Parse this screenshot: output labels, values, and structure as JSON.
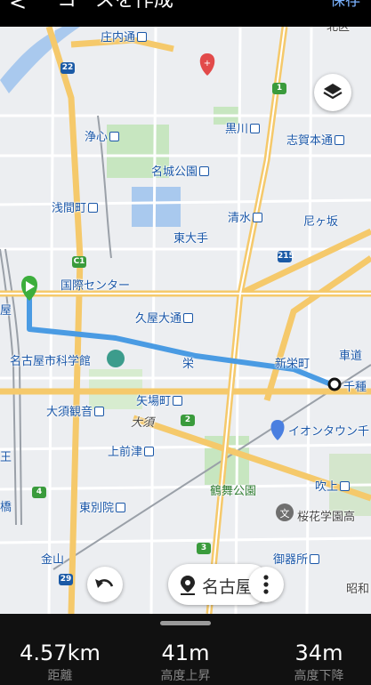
{
  "header": {
    "back_glyph": "<",
    "title": "コースを作成",
    "save_label": "保存"
  },
  "map": {
    "labels": {
      "kita_ku": "北区",
      "shounai_dori": "庄内通",
      "jyoshin": "浄心",
      "kuroka": "黒川",
      "shigahondori": "志賀本通",
      "meijo_koen": "名城公園",
      "sengen_cho": "浅間町",
      "shimizu": "清水",
      "amagasaka": "尼ヶ坂",
      "higashi_ote": "東大手",
      "kokusai_center": "国際センター",
      "hisaya_odori": "久屋大通",
      "nagoya_left": "屋",
      "sakae": "栄",
      "shinsakae": "新栄町",
      "kurumamichi": "車道",
      "chikusa": "千種",
      "science_museum": "名古屋市科学館",
      "yabacho": "矢場町",
      "osu_kannon": "大須観音",
      "osu": "大須",
      "ion_town": "イオンタウン千",
      "kamimaezu": "上前津",
      "tsurumai_koen": "鶴舞公園",
      "fukiage": "吹上",
      "higashi_betsuin": "東別院",
      "oukagakuen": "桜花学園高",
      "kanayama": "金山",
      "gokisho": "御器所",
      "showa": "昭和",
      "left_ou": "王",
      "left_bashi": "橋"
    },
    "routes": [
      "1",
      "22",
      "C1",
      "215",
      "2",
      "4",
      "3",
      "29"
    ],
    "route_colors": {
      "route": "#4a9be3",
      "start": "#3cae3c",
      "end": "#111111"
    }
  },
  "controls": {
    "search_text": "名古屋"
  },
  "stats": [
    {
      "value": "4.57km",
      "label": "距離"
    },
    {
      "value": "41m",
      "label": "高度上昇"
    },
    {
      "value": "34m",
      "label": "高度下降"
    }
  ]
}
